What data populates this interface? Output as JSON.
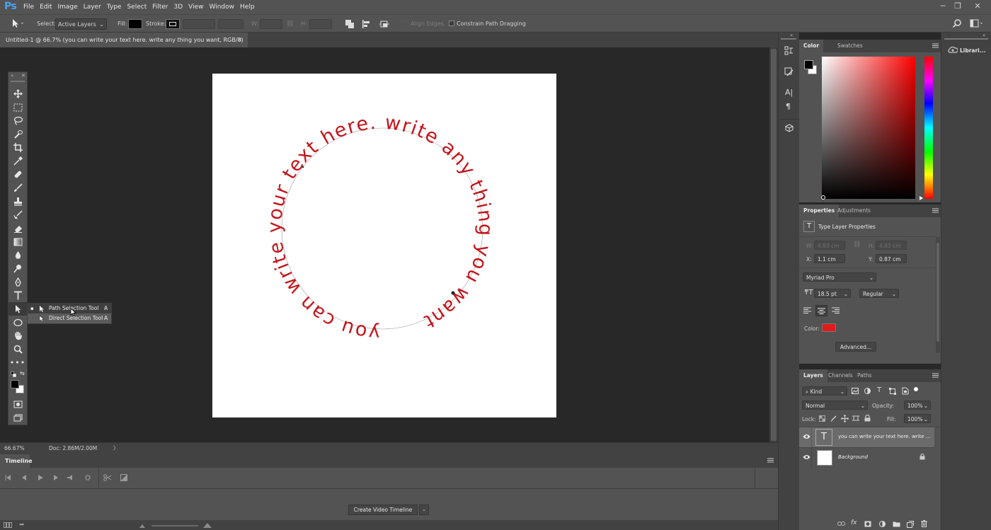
{
  "app": {
    "logo": "Ps"
  },
  "menu": [
    "File",
    "Edit",
    "Image",
    "Layer",
    "Type",
    "Select",
    "Filter",
    "3D",
    "View",
    "Window",
    "Help"
  ],
  "window_controls": {
    "minimize": "─",
    "restore": "❐",
    "close": "✕"
  },
  "options": {
    "select_label": "Select:",
    "select_value": "Active Layers",
    "fill_label": "Fill:",
    "stroke_label": "Stroke:",
    "w_label": "W:",
    "h_label": "H:",
    "align_edges": "Align Edges",
    "constrain": "Constrain Path Dragging"
  },
  "doc_tab": {
    "title": "Untitled-1 @ 66.7% (you can write your text here. write any thing you want, RGB/8) *",
    "close": "✕"
  },
  "canvas": {
    "circle_text": "you can write your text here. write any thing you want",
    "text_color": "#c3161c"
  },
  "flyout": {
    "items": [
      {
        "label": "Path Selection Tool",
        "shortcut": "A"
      },
      {
        "label": "Direct Selection Tool",
        "shortcut": "A"
      }
    ]
  },
  "status": {
    "zoom": "66.67%",
    "doc": "Doc: 2.86M/2.00M",
    "arrow": "〉"
  },
  "timeline": {
    "title": "Timeline",
    "create_button": "Create Video Timeline"
  },
  "color_panel": {
    "tabs": [
      "Color",
      "Swatches"
    ],
    "fg": "#000000",
    "bg": "#ffffff",
    "hue_color": "#ff0000"
  },
  "properties": {
    "tabs": [
      "Properties",
      "Adjustments"
    ],
    "header": "Type Layer Properties",
    "w_label": "W:",
    "w_value": "4.83 cm",
    "h_label": "H:",
    "h_value": "4.83 cm",
    "x_label": "X:",
    "x_value": "1.1 cm",
    "y_label": "Y:",
    "y_value": "0.87 cm",
    "font": "Myriad Pro",
    "size": "18.5 pt",
    "style": "Regular",
    "color_label": "Color:",
    "text_color": "#e01b1b",
    "advanced": "Advanced..."
  },
  "layers": {
    "tabs": [
      "Layers",
      "Channels",
      "Paths"
    ],
    "kind": "Kind",
    "blend": "Normal",
    "opacity_label": "Opacity:",
    "opacity": "100%",
    "lock_label": "Lock:",
    "fill_label": "Fill:",
    "fill": "100%",
    "items": [
      {
        "name": "you can write your text here. write ...",
        "type": "text",
        "selected": true
      },
      {
        "name": "Background",
        "type": "bg",
        "selected": false
      }
    ]
  },
  "libraries": {
    "label": "Librari..."
  }
}
